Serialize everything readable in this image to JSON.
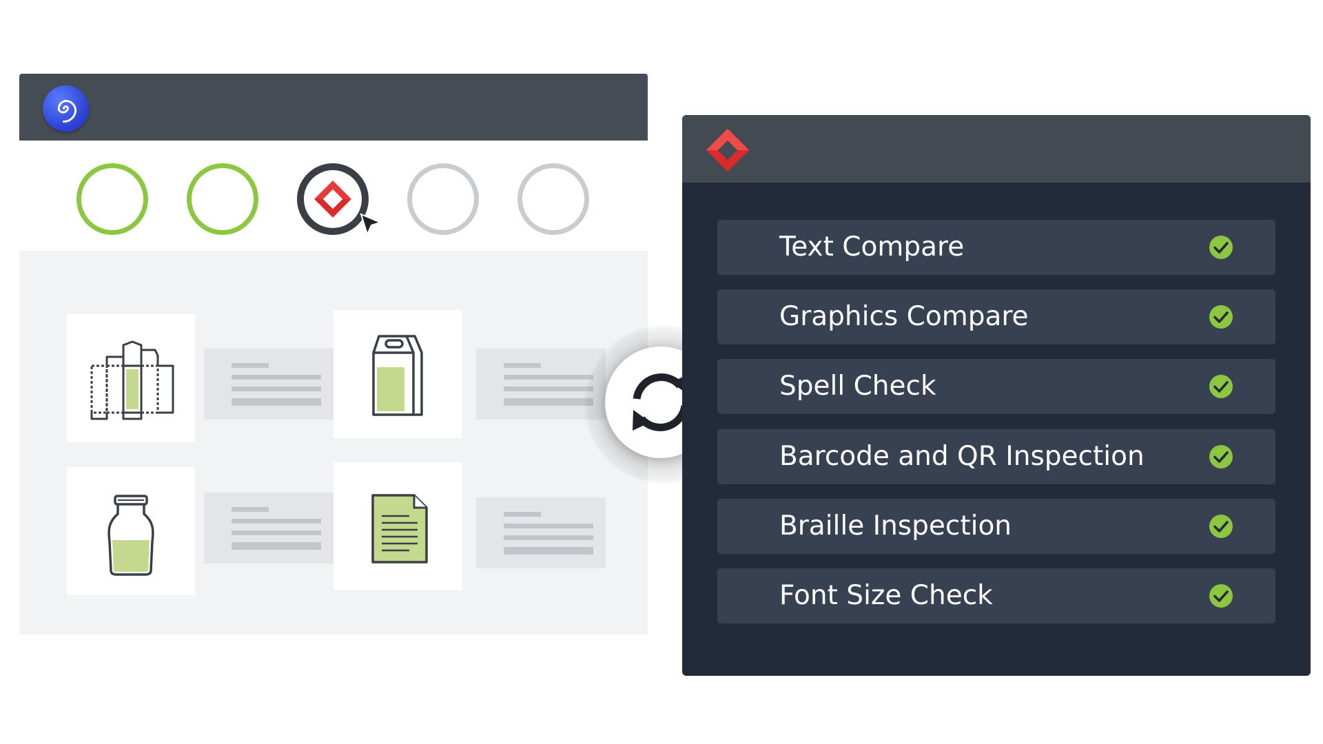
{
  "left_window": {
    "app_logo_icon": "spiral-icon",
    "steps": [
      {
        "state": "done"
      },
      {
        "state": "done"
      },
      {
        "state": "active",
        "icon": "diamond-logo-icon"
      },
      {
        "state": "pending"
      },
      {
        "state": "pending"
      }
    ],
    "thumbnails": [
      {
        "icon": "folding-carton-icon"
      },
      {
        "icon": "pouch-bag-icon"
      },
      {
        "icon": "bottle-icon"
      },
      {
        "icon": "document-icon"
      }
    ]
  },
  "sync_button": {
    "icon": "sync-arrows-icon"
  },
  "right_window": {
    "brand_logo_icon": "diamond-logo-icon",
    "features": [
      {
        "label": "Text Compare",
        "status_icon": "check-circle-icon"
      },
      {
        "label": "Graphics Compare",
        "status_icon": "check-circle-icon"
      },
      {
        "label": "Spell Check",
        "status_icon": "check-circle-icon"
      },
      {
        "label": "Barcode and QR Inspection",
        "status_icon": "check-circle-icon"
      },
      {
        "label": "Braille Inspection",
        "status_icon": "check-circle-icon"
      },
      {
        "label": "Font Size Check",
        "status_icon": "check-circle-icon"
      }
    ]
  },
  "colors": {
    "accent_green": "#8dc63f",
    "brand_red": "#d92b2b",
    "dark_panel": "#232b3b",
    "row_bg": "#384152",
    "titlebar": "#454c53",
    "logo_blue": "#3550e8"
  }
}
